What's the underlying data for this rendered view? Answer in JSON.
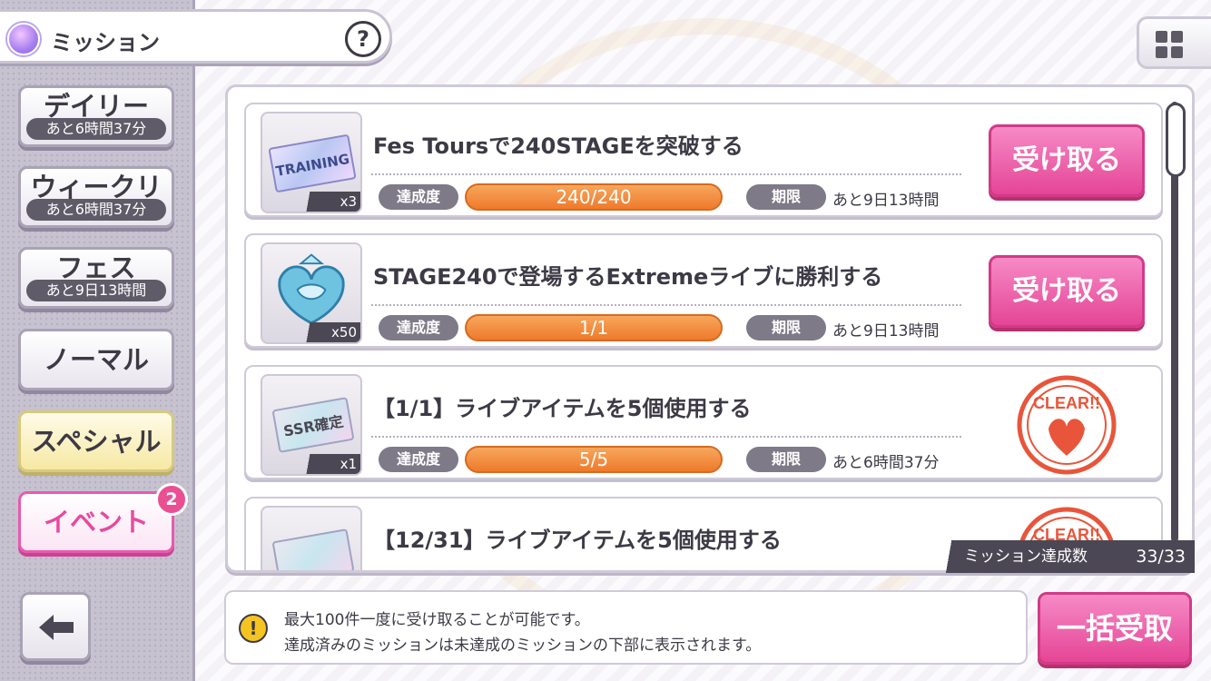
{
  "header": {
    "title": "ミッション",
    "help_label": "?"
  },
  "sidebar": {
    "tabs": [
      {
        "label": "デイリー",
        "timer": "あと6時間37分"
      },
      {
        "label": "ウィークリー",
        "timer": "あと6時間37分"
      },
      {
        "label": "フェス",
        "timer": "あと9日13時間"
      },
      {
        "label": "ノーマル"
      },
      {
        "label": "スペシャル"
      },
      {
        "label": "イベント",
        "badge": "2"
      }
    ]
  },
  "missions": [
    {
      "title": "Fes Toursで240STAGEを突破する",
      "reward_icon": "training-ticket",
      "ticket_text": "TRAINING",
      "quantity": "x3",
      "progress_label": "達成度",
      "progress": "240/240",
      "deadline_label": "期限",
      "deadline": "あと9日13時間",
      "action": "受け取る"
    },
    {
      "title": "STAGE240で登場するExtremeライブに勝利する",
      "reward_icon": "swan-emblem",
      "quantity": "x50",
      "progress_label": "達成度",
      "progress": "1/1",
      "deadline_label": "期限",
      "deadline": "あと9日13時間",
      "action": "受け取る"
    },
    {
      "title": "【1/1】ライブアイテムを5個使用する",
      "reward_icon": "ssr-ticket",
      "ticket_text": "SSR確定",
      "quantity": "x1",
      "progress_label": "達成度",
      "progress": "5/5",
      "deadline_label": "期限",
      "deadline": "あと6時間37分",
      "stamp": "CLEAR!!"
    },
    {
      "title": "【12/31】ライブアイテムを5個使用する",
      "reward_icon": "ssr-ticket",
      "stamp": "CLEAR!!"
    }
  ],
  "counter": {
    "label": "ミッション達成数",
    "value": "33/33"
  },
  "info": {
    "line1": "最大100件一度に受け取ることが可能です。",
    "line2": "達成済みのミッションは未達成のミッションの下部に表示されます。"
  },
  "bulk_button": "一括受取",
  "colors": {
    "accent_pink": "#e54596",
    "progress_orange": "#ef7a2c",
    "stamp_red": "#e8553a"
  }
}
